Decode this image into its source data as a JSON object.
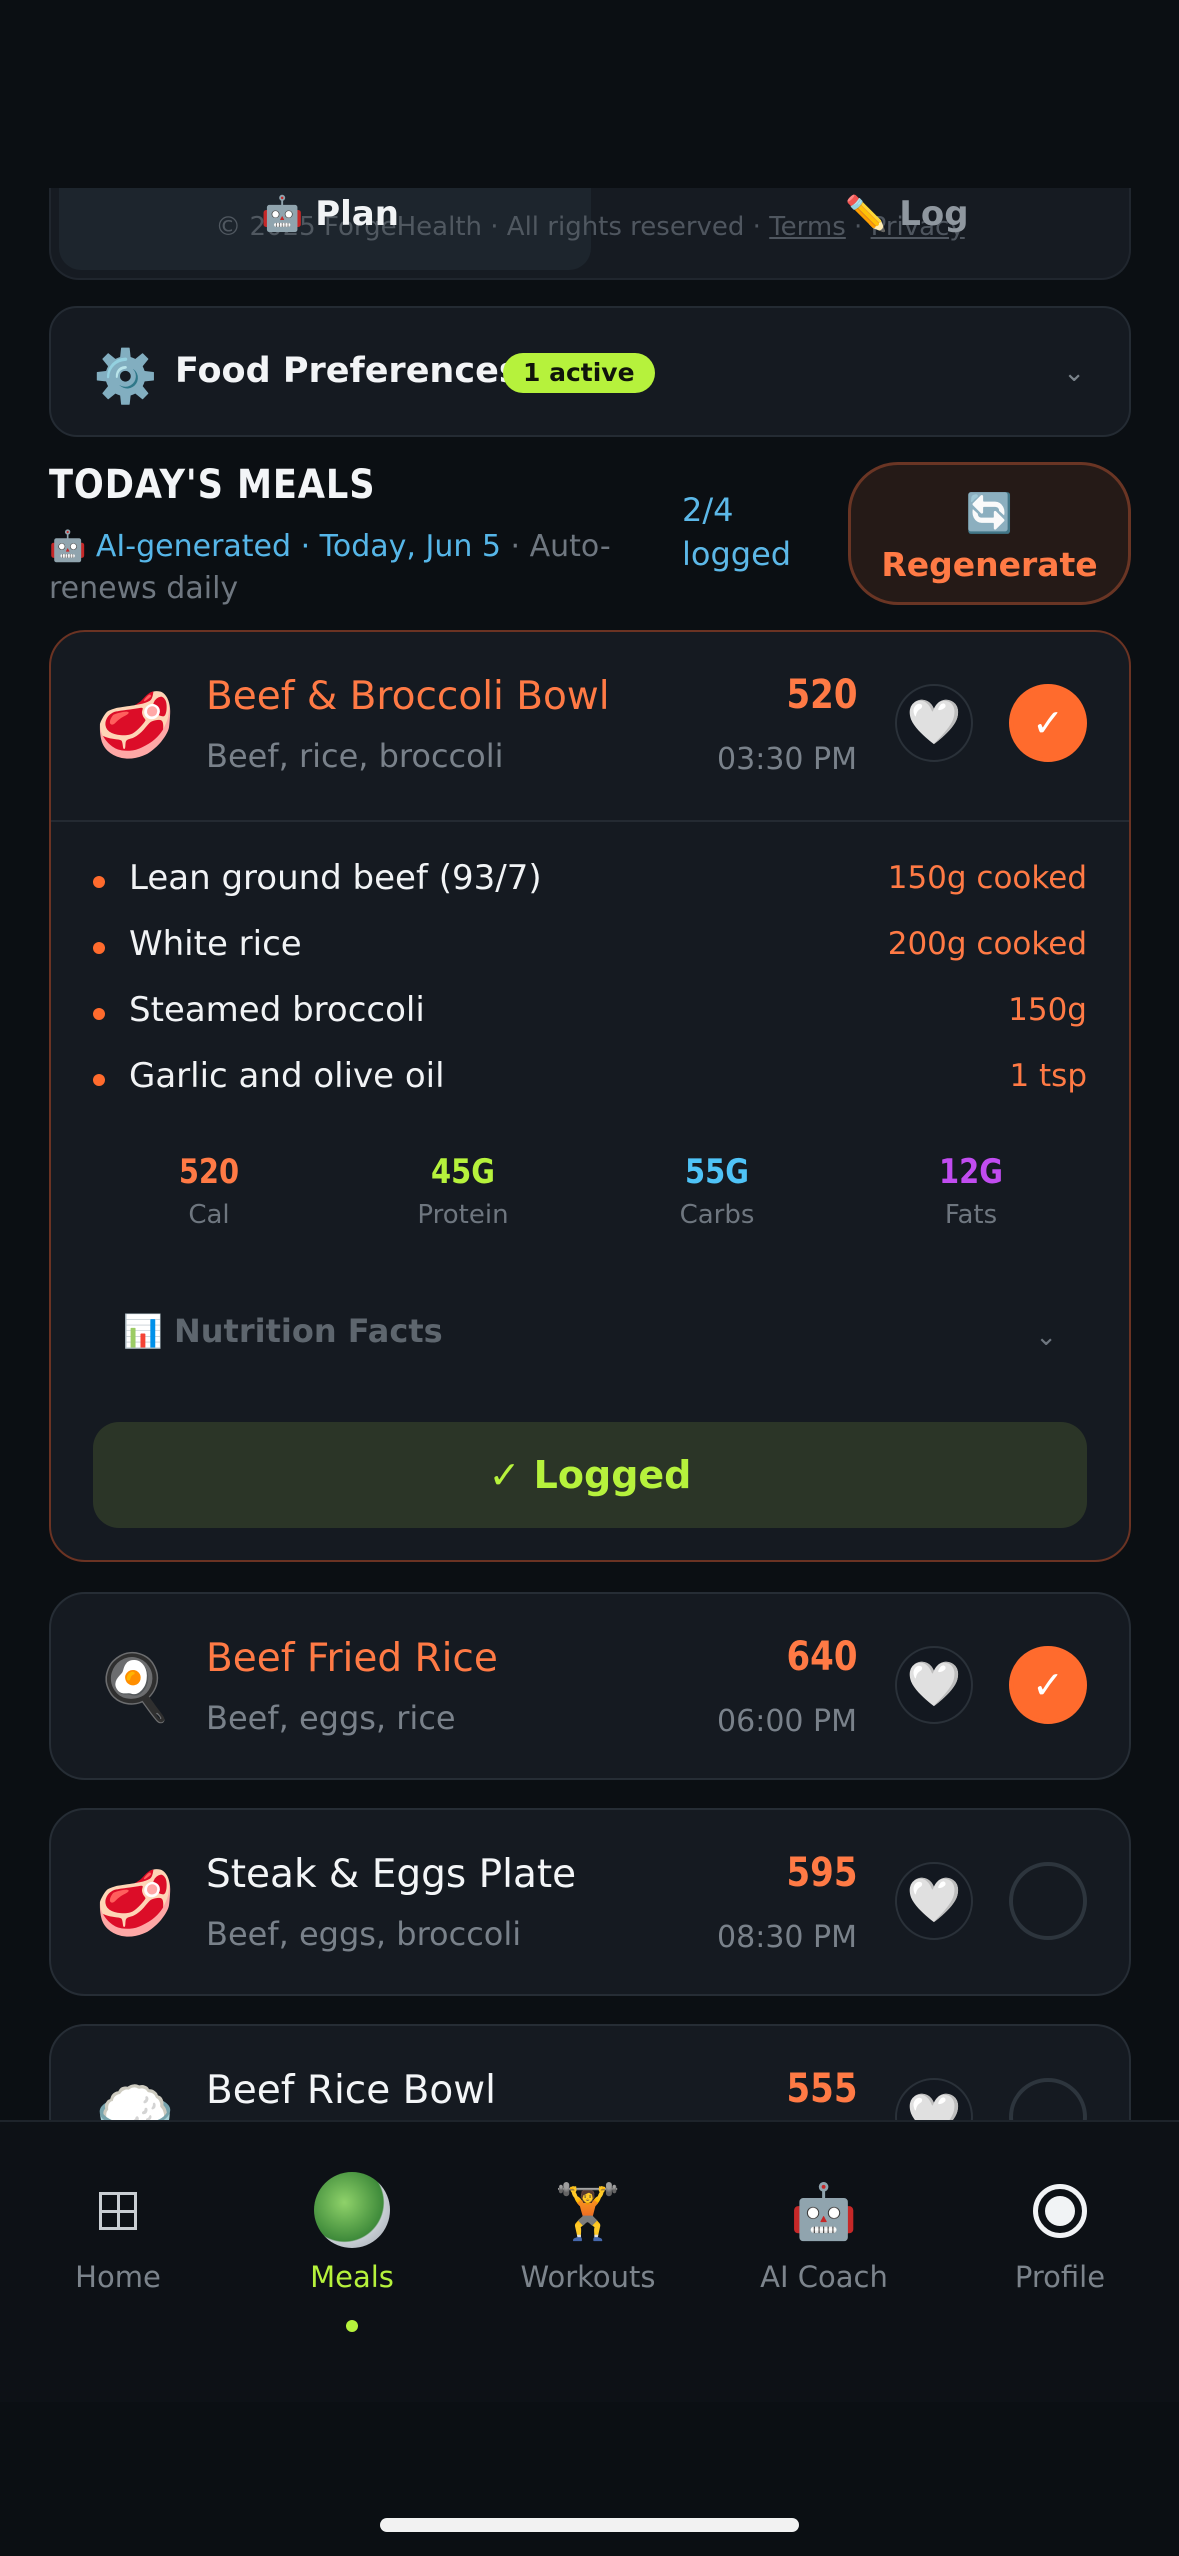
{
  "segmented": {
    "plan_icon": "🤖",
    "plan_label": "Plan",
    "log_icon": "✏️",
    "log_label": "Log",
    "footer_text": "© 2025 ForgeHealth · All rights reserved · ",
    "footer_terms": "Terms",
    "footer_sep": " · ",
    "footer_privacy": "Privacy"
  },
  "preferences": {
    "icon": "⚙️",
    "title": "Food Preferences",
    "badge": "1 active",
    "chevron": "⌄"
  },
  "meals_header": {
    "title": "TODAY'S MEALS",
    "ai_icon": "🤖",
    "ai_text": "AI-generated · Today, Jun 5",
    "renew_text": " · Auto-renews daily",
    "logged_count": "2/4",
    "logged_label": "logged",
    "regenerate_icon": "🔄",
    "regenerate_label": "Regenerate"
  },
  "meals": [
    {
      "emoji": "🥩",
      "name": "Beef & Broccoli Bowl",
      "desc": "Beef, rice, broccoli",
      "calories": "520",
      "time": "03:30 PM",
      "fav_icon": "🤍",
      "check": "✓",
      "ingredients": [
        {
          "name": "Lean ground beef (93/7)",
          "amount": "150g cooked"
        },
        {
          "name": "White rice",
          "amount": "200g cooked"
        },
        {
          "name": "Steamed broccoli",
          "amount": "150g"
        },
        {
          "name": "Garlic and olive oil",
          "amount": "1 tsp"
        }
      ],
      "macros": [
        {
          "value": "520",
          "label": "Cal",
          "color": "#ff7a45"
        },
        {
          "value": "45G",
          "label": "Protein",
          "color": "#b6f23c"
        },
        {
          "value": "55G",
          "label": "Carbs",
          "color": "#4fc3f7"
        },
        {
          "value": "12G",
          "label": "Fats",
          "color": "#c14cf0"
        }
      ],
      "nutrition_icon": "📊",
      "nutrition_label": "Nutrition Facts",
      "nutrition_chevron": "⌄",
      "logged_label": "✓ Logged"
    },
    {
      "emoji": "🍳",
      "name": "Beef Fried Rice",
      "desc": "Beef, eggs, rice",
      "calories": "640",
      "time": "06:00 PM",
      "fav_icon": "🤍",
      "check": "✓"
    },
    {
      "emoji": "🥩",
      "name": "Steak & Eggs Plate",
      "desc": "Beef, eggs, broccoli",
      "calories": "595",
      "time": "08:30 PM",
      "fav_icon": "🤍",
      "check": ""
    },
    {
      "emoji": "🍚",
      "name": "Beef Rice Bowl",
      "calories": "555",
      "fav_icon": "🤍",
      "check": ""
    }
  ],
  "nav": {
    "home": "Home",
    "meals": "Meals",
    "workouts_icon": "🏋️",
    "workouts": "Workouts",
    "coach_icon": "🤖",
    "coach": "AI Coach",
    "profile": "Profile"
  }
}
